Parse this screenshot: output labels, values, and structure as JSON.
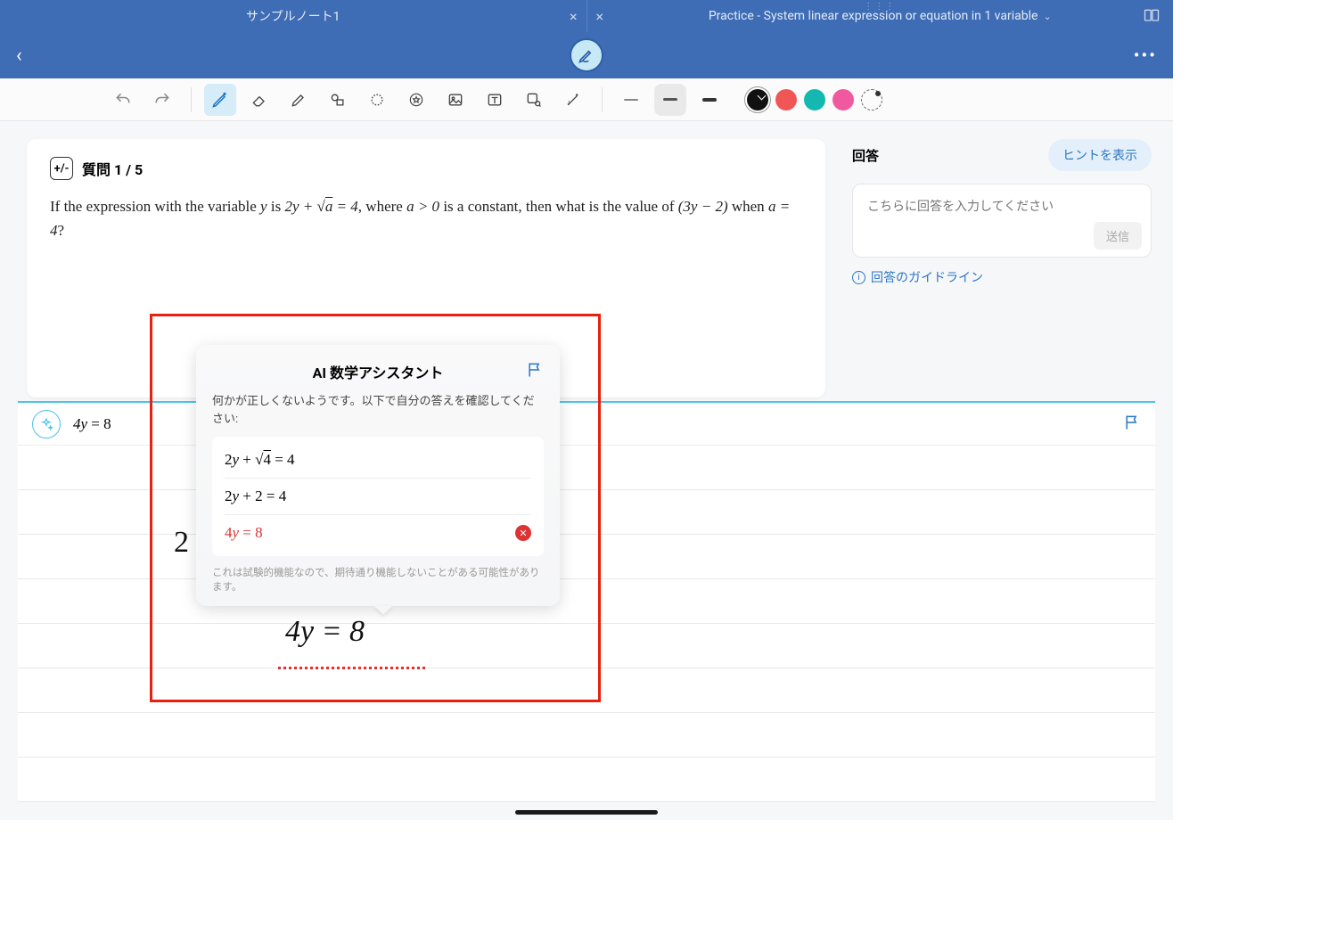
{
  "tabs": {
    "left_title": "サンプルノート1",
    "right_title": "Practice - System linear expression or equation in 1 variable"
  },
  "question": {
    "counter_label": "質問 1 / 5",
    "text_prefix": "If the expression with the variable ",
    "var_y": "y",
    "text_is": " is ",
    "expr1": "2y + √a = 4",
    "text_where": ", where ",
    "cond": "a > 0",
    "text_const": " is a constant, then what is the value of ",
    "expr2": "(3y − 2)",
    "text_when": " when ",
    "cond2": "a = 4",
    "text_end": "?"
  },
  "answer": {
    "title": "回答",
    "hint_label": "ヒントを表示",
    "placeholder": "こちらに回答を入力してください",
    "send_label": "送信",
    "guideline_label": "回答のガイドライン"
  },
  "work": {
    "header_eq": "4y = 8",
    "handwriting": "4y = 8",
    "partial": "2"
  },
  "ai_popup": {
    "title": "AI 数学アシスタント",
    "message": "何かが正しくないようです。以下で自分の答えを確認してください:",
    "step1": "2y + √4 = 4",
    "step2": "2y + 2 = 4",
    "step3": "4y = 8",
    "disclaimer": "これは試験的機能なので、期待通り機能しないことがある可能性があります。"
  },
  "colors": {
    "brand": "#3e6cb5",
    "accent": "#2976c4",
    "cyan": "#4cc4e8",
    "error": "#d33"
  }
}
